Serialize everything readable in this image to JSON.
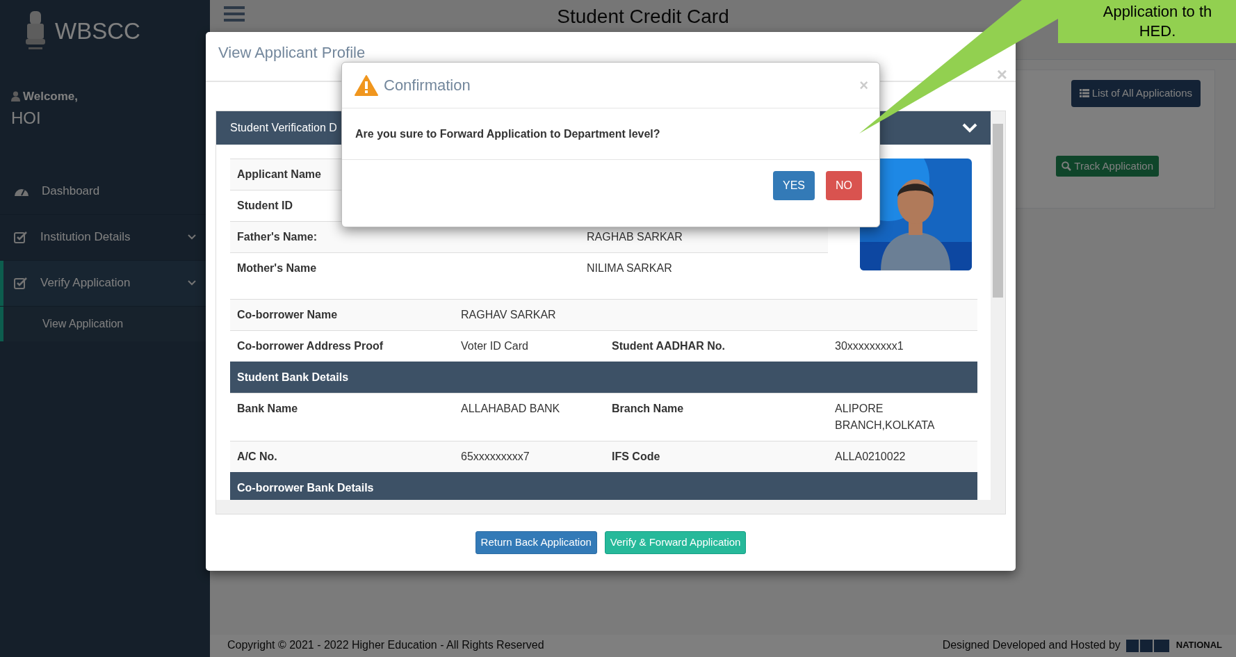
{
  "sidebar": {
    "brand": "WBSCC",
    "welcome": "Welcome,",
    "user": "HOI",
    "items": [
      {
        "label": "Dashboard",
        "kind": "link",
        "selected": false
      },
      {
        "label": "Institution Details",
        "kind": "dropdown",
        "selected": false
      },
      {
        "label": "Verify Application",
        "kind": "dropdown",
        "selected": true,
        "children": [
          {
            "label": "View Application",
            "selected": true
          }
        ]
      }
    ]
  },
  "page": {
    "title": "Student Credit Card",
    "list_button": "List of All Applications",
    "track_button": "Track Application"
  },
  "footer": {
    "copyright": "Copyright © 2021 - 2022 Higher Education - All Rights Reserved",
    "credit": "Designed Developed and Hosted by",
    "logo_text": "NATIONAL"
  },
  "modal": {
    "title": "View Applicant Profile",
    "close": "×",
    "panel_title": "Student Verification D",
    "top_rows": [
      {
        "label": "Applicant Name"
      },
      {
        "label": "Student ID"
      },
      {
        "label": "Father's Name:",
        "value": "RAGHAB SARKAR"
      },
      {
        "label": "Mother's Name",
        "value": "NILIMA SARKAR"
      }
    ],
    "rows": [
      {
        "kind": "pair",
        "cells": [
          "Co-borrower Name",
          "RAGHAV SARKAR"
        ]
      },
      {
        "kind": "quad",
        "cells": [
          "Co-borrower Address Proof",
          "Voter ID Card",
          "Student AADHAR No.",
          "30xxxxxxxxx1"
        ]
      },
      {
        "kind": "section",
        "cells": [
          "Student Bank Details"
        ]
      },
      {
        "kind": "quad",
        "cells": [
          "Bank Name",
          "ALLAHABAD BANK",
          "Branch Name",
          "ALIPORE BRANCH,KOLKATA"
        ]
      },
      {
        "kind": "quad",
        "cells": [
          "A/C No.",
          "65xxxxxxxxx7",
          "IFS Code",
          "ALLA0210022"
        ]
      },
      {
        "kind": "section",
        "cells": [
          "Co-borrower Bank Details"
        ]
      }
    ],
    "buttons": [
      {
        "label": "Return Back Application",
        "kind": "primary"
      },
      {
        "label": "Verify & Forward Application",
        "kind": "success"
      }
    ]
  },
  "confirm": {
    "title": "Confirmation",
    "close": "×",
    "message": "Are you sure to Forward Application to Department level?",
    "buttons": [
      {
        "label": "YES",
        "kind": "primary"
      },
      {
        "label": "NO",
        "kind": "danger"
      }
    ]
  },
  "callout": {
    "lines": [
      "Application to th",
      "HED."
    ]
  }
}
